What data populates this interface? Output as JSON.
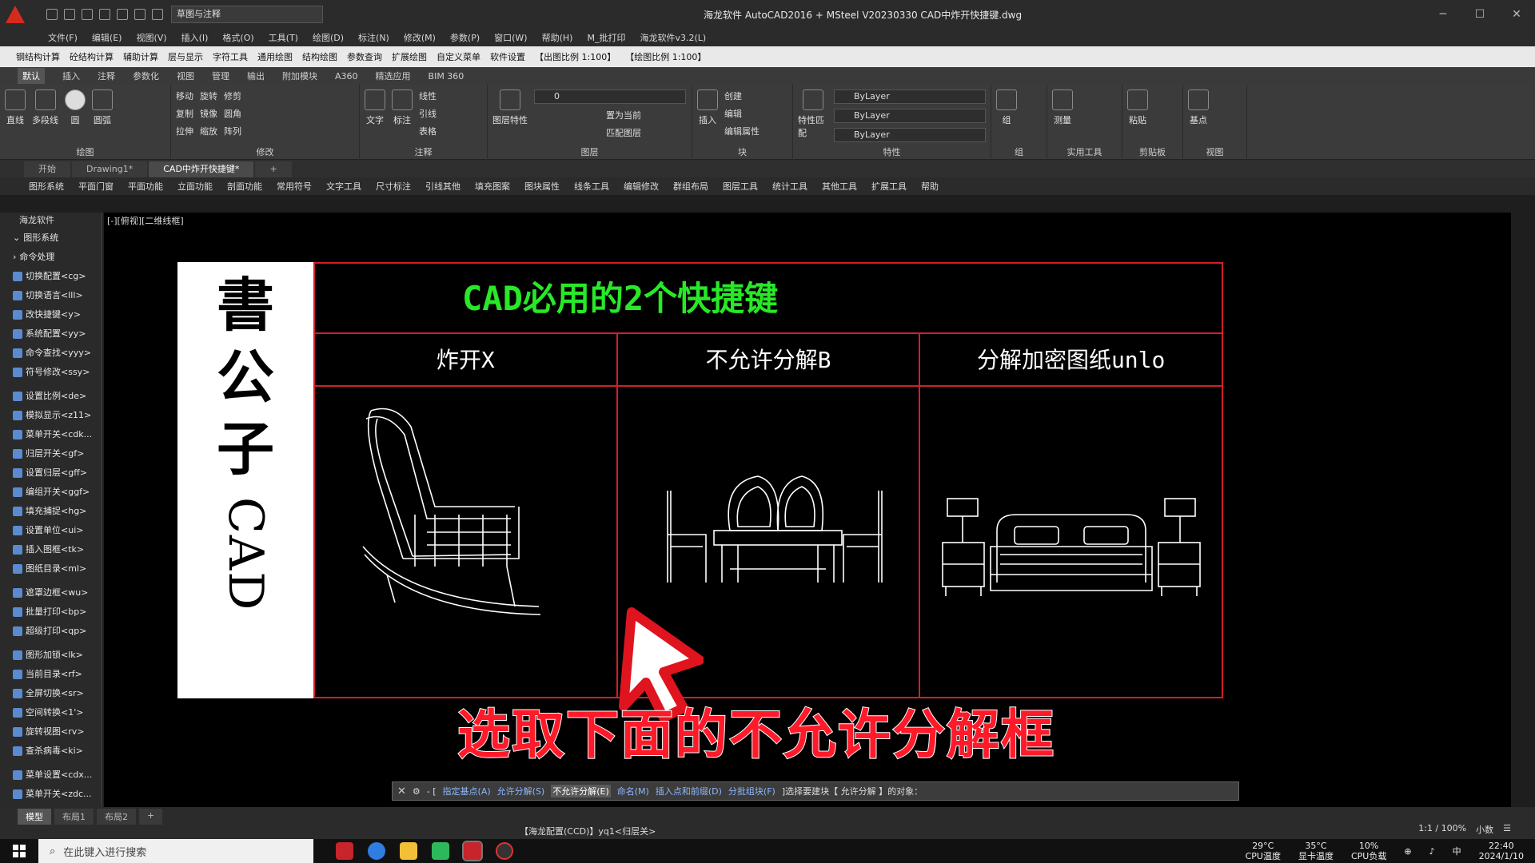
{
  "titlebar": {
    "workspace": "草图与注释",
    "title": "海龙软件 AutoCAD2016 + MSteel V20230330     CAD中炸开快捷键.dwg"
  },
  "menu": [
    "文件(F)",
    "编辑(E)",
    "视图(V)",
    "插入(I)",
    "格式(O)",
    "工具(T)",
    "绘图(D)",
    "标注(N)",
    "修改(M)",
    "参数(P)",
    "窗口(W)",
    "帮助(H)",
    "M_批打印",
    "海龙软件v3.2(L)"
  ],
  "toolbar1": [
    "钢结构计算",
    "砼结构计算",
    "辅助计算",
    "层与显示",
    "字符工具",
    "通用绘图",
    "结构绘图",
    "参数查询",
    "扩展绘图",
    "自定义菜单",
    "软件设置",
    "【出图比例 1:100】",
    "【绘图比例 1:100】"
  ],
  "ribbon_tabs": [
    "默认",
    "插入",
    "注释",
    "参数化",
    "视图",
    "管理",
    "输出",
    "附加模块",
    "A360",
    "精选应用",
    "BIM 360"
  ],
  "ribbon": {
    "draw": {
      "name": "绘图",
      "tools": [
        "直线",
        "多段线",
        "圆",
        "圆弧"
      ]
    },
    "modify": {
      "name": "修改",
      "items": [
        "移动",
        "旋转",
        "修剪",
        "复制",
        "镜像",
        "圆角",
        "拉伸",
        "缩放",
        "阵列"
      ]
    },
    "annotation": {
      "name": "注释",
      "tools": [
        "文字",
        "标注"
      ],
      "items": [
        "线性",
        "引线",
        "表格"
      ]
    },
    "layer": {
      "name": "图层",
      "tool": "图层特性",
      "current": "0",
      "items": [
        "置为当前",
        "匹配图层"
      ]
    },
    "block": {
      "name": "块",
      "tool": "插入",
      "items": [
        "创建",
        "编辑",
        "编辑属性"
      ]
    },
    "properties": {
      "name": "特性",
      "tool": "特性匹配",
      "values": [
        "ByLayer",
        "ByLayer",
        "ByLayer"
      ]
    },
    "others": [
      {
        "name": "组",
        "tool": "组"
      },
      {
        "name": "实用工具",
        "tool": "测量"
      },
      {
        "name": "剪贴板",
        "tool": "粘贴"
      },
      {
        "name": "视图",
        "tool": "基点"
      }
    ]
  },
  "doc_tabs": [
    "开始",
    "Drawing1*",
    "CAD中炸开快捷键*"
  ],
  "plugin_menu": [
    "图形系统",
    "平面门窗",
    "平面功能",
    "立面功能",
    "剖面功能",
    "常用符号",
    "文字工具",
    "尺寸标注",
    "引线其他",
    "填充图案",
    "图块属性",
    "线条工具",
    "编辑修改",
    "群组布局",
    "图层工具",
    "统计工具",
    "其他工具",
    "扩展工具",
    "帮助"
  ],
  "sidebar": {
    "title": "海龙软件",
    "section": "图形系统",
    "items": [
      "命令处理",
      "切换配置<cg>",
      "切换语言<lll>",
      "改快捷键<y>",
      "系统配置<yy>",
      "命令查找<yyy>",
      "符号修改<ssy>",
      "设置比例<de>",
      "模拟显示<z11>",
      "菜单开关<cdk...",
      "归层开关<gf>",
      "设置归层<gff>",
      "编组开关<ggf>",
      "填充捕捉<hg>",
      "设置单位<ui>",
      "插入图框<tk>",
      "图纸目录<ml>",
      "遮罩边框<wu>",
      "批量打印<bp>",
      "超级打印<qp>",
      "图形加锁<lk>",
      "当前目录<rf>",
      "全屏切换<sr>",
      "空间转换<1'>",
      "旋转视图<rv>",
      "查杀病毒<ki>",
      "菜单设置<cdx...",
      "菜单开关<zdc..."
    ]
  },
  "canvas": {
    "view_label": "[-][俯视][二维线框]",
    "seal_chars": [
      "書",
      "公",
      "子"
    ],
    "seal_cad": "CAD",
    "table_title": "CAD必用的2个快捷键",
    "columns": [
      "炸开X",
      "不允许分解B",
      "分解加密图纸unlo"
    ],
    "subtitle": "选取下面的不允许分解框"
  },
  "command": {
    "prefix": "- [",
    "opt1": "指定基点(A)",
    "opt2": "允许分解(S)",
    "opt3": "不允许分解(E)",
    "opt4": "命名(M)",
    "opt5": "插入点和前缀(D)",
    "opt6": "分批组块(F)",
    "suffix": "]选择要建块【 允许分解 】的对象："
  },
  "status": {
    "layouts": [
      "模型",
      "布局1",
      "布局2"
    ],
    "text": "【海龙配置(CCD)】yq1<归层关>",
    "scale": "1:1 / 100%",
    "units": "小数"
  },
  "taskbar": {
    "search_placeholder": "在此键入进行搜索",
    "cpu_temp_value": "29°C",
    "cpu_temp_label": "CPU温度",
    "gpu_temp_value": "35°C",
    "gpu_temp_label": "显卡温度",
    "cpu_load_value": "10%",
    "cpu_load_label": "CPU负载",
    "ime": "中",
    "time": "22:40",
    "date": "2024/1/10"
  },
  "colors": {
    "accent_red": "#d0202a",
    "title_green": "#28e828",
    "subtitle_red": "#ff1a2a"
  }
}
